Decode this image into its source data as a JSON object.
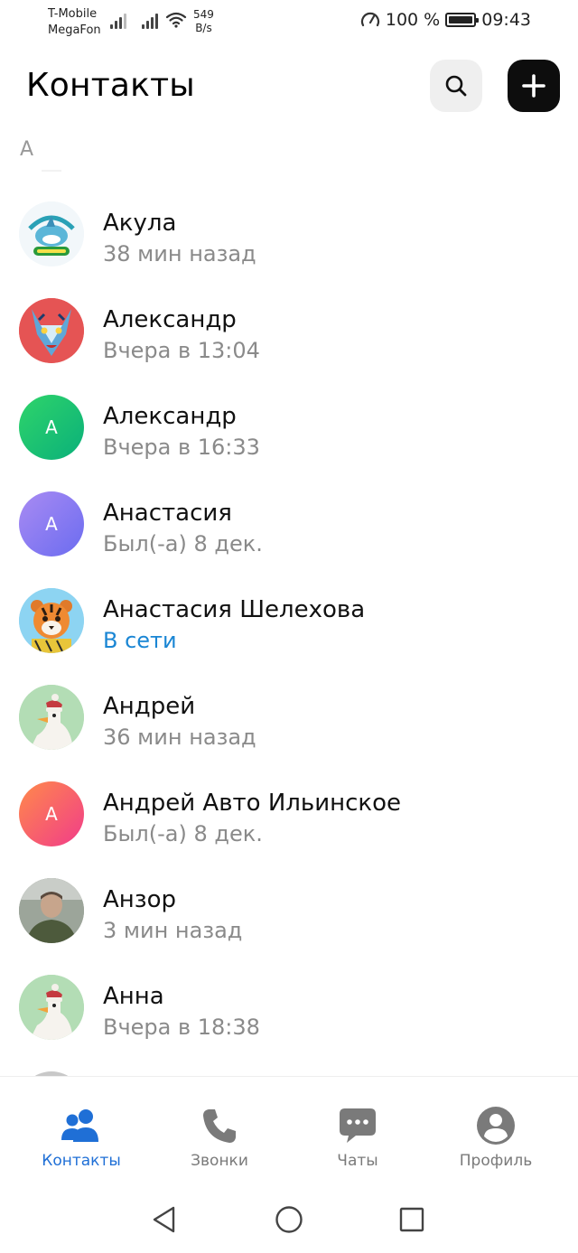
{
  "status_bar": {
    "carrier_1": "T-Mobile",
    "carrier_2": "MegaFon",
    "net_speed_value": "549",
    "net_speed_unit": "B/s",
    "battery_percent": "100 %",
    "time": "09:43",
    "icons": [
      "signal-icon",
      "signal-icon",
      "wifi-icon",
      "speedometer-icon",
      "battery-icon"
    ]
  },
  "header": {
    "title": "Контакты",
    "search_icon": "search-icon",
    "add_icon": "plus-icon"
  },
  "section": {
    "letter": "А"
  },
  "contacts": [
    {
      "name": "Акула",
      "status": "38 мин назад",
      "online": false,
      "avatar": "photo-shark-logo"
    },
    {
      "name": "Александр",
      "status": "Вчера в 13:04",
      "online": false,
      "avatar": "photo-wolf"
    },
    {
      "name": "Александр",
      "status": "Вчера в 16:33",
      "online": false,
      "avatar_letter": "А",
      "avatar_color": "green"
    },
    {
      "name": "Анастасия",
      "status": "Был(-а) 8 дек.",
      "online": false,
      "avatar_letter": "А",
      "avatar_color": "purple"
    },
    {
      "name": "Анастасия Шелехова",
      "status": "В сети",
      "online": true,
      "avatar": "photo-tiger"
    },
    {
      "name": "Андрей",
      "status": "36 мин назад",
      "online": false,
      "avatar": "photo-goose"
    },
    {
      "name": "Андрей Авто Ильинское",
      "status": "Был(-а) 8 дек.",
      "online": false,
      "avatar_letter": "А",
      "avatar_color": "pink-orange"
    },
    {
      "name": "Анзор",
      "status": "3 мин назад",
      "online": false,
      "avatar": "photo-person"
    },
    {
      "name": "Анна",
      "status": "Вчера в 18:38",
      "online": false,
      "avatar": "photo-goose"
    }
  ],
  "tabs": [
    {
      "label": "Контакты",
      "icon": "contacts-icon",
      "active": true
    },
    {
      "label": "Звонки",
      "icon": "phone-icon",
      "active": false
    },
    {
      "label": "Чаты",
      "icon": "chat-icon",
      "active": false
    },
    {
      "label": "Профиль",
      "icon": "profile-icon",
      "active": false
    }
  ],
  "colors": {
    "accent": "#1f6fd6",
    "online": "#1a86d4",
    "secondary_text": "#8a8a8a"
  }
}
